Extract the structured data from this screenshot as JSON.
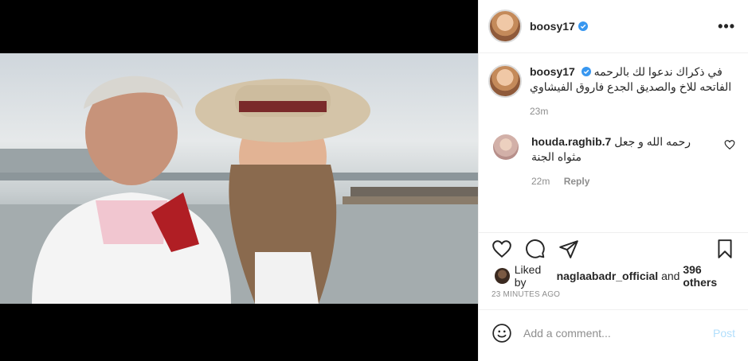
{
  "post": {
    "username": "boosy17",
    "caption": "في ذكراك ندعوا لك بالرحمه الفاتحه للاخ والصديق الجدع فاروق الفيشاوي",
    "caption_time": "23m"
  },
  "comments": [
    {
      "username": "houda.raghib.7",
      "text": "رحمه الله و جعل مثواه الجنة",
      "time": "22m",
      "reply_label": "Reply"
    }
  ],
  "likes": {
    "prefix": "Liked by",
    "user": "naglaabadr_official",
    "and": "and",
    "others": "396 others"
  },
  "timestamp": "23 MINUTES AGO",
  "composer": {
    "placeholder": "Add a comment...",
    "post_label": "Post"
  },
  "colors": {
    "verified": "#3897f0",
    "post_disabled": "#b2dffc",
    "muted": "#8e8e8e"
  }
}
